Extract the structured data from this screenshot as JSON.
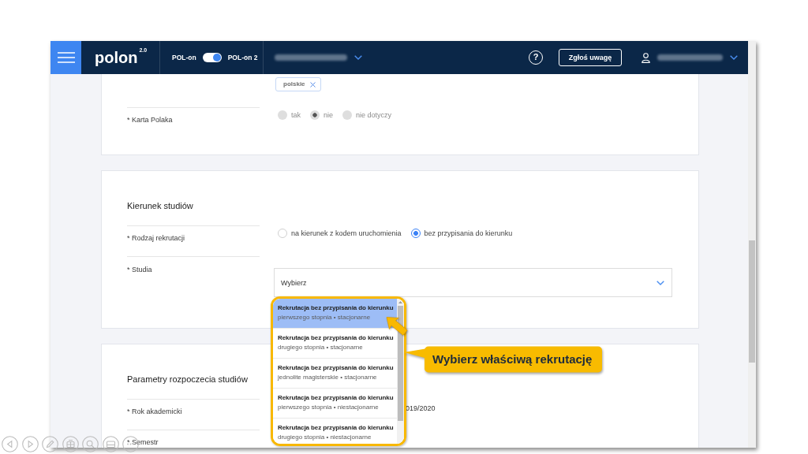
{
  "header": {
    "logo": "polon",
    "logo_version": "2.0",
    "switch": {
      "left_label": "POL-on",
      "on": true,
      "right_label": "POL-on 2"
    },
    "institution": {
      "blurred": true
    },
    "help": "?",
    "report_button": "Zgłoś uwagę",
    "user": {
      "blurred": true
    }
  },
  "sections": [
    {
      "fields": [
        {
          "kind": "chips",
          "chips": [
            {
              "label": "polskie"
            }
          ]
        },
        {
          "kind": "radio",
          "label": "* Karta Polaka",
          "disabled": true,
          "options": [
            {
              "label": "tak",
              "selected": false
            },
            {
              "label": "nie",
              "selected": true
            },
            {
              "label": "nie dotyczy",
              "selected": false
            }
          ]
        }
      ]
    },
    {
      "title": "Kierunek studiów",
      "fields": [
        {
          "kind": "radio",
          "label": "* Rodzaj rekrutacji",
          "disabled": false,
          "options": [
            {
              "label": "na kierunek z kodem uruchomienia",
              "selected": false
            },
            {
              "label": "bez przypisania do kierunku",
              "selected": true
            }
          ]
        },
        {
          "kind": "select",
          "label": "* Studia",
          "placeholder": "Wybierz",
          "expanded": true,
          "options": [
            {
              "title": "Rekrutacja bez przypisania do kierunku",
              "detail": "pierwszego stopnia • stacjonarne",
              "selected": true
            },
            {
              "title": "Rekrutacja bez przypisania do kierunku",
              "detail": "drugiego stopnia • stacjonarne",
              "selected": false
            },
            {
              "title": "Rekrutacja bez przypisania do kierunku",
              "detail": "jednolite magisterskie • stacjonarne",
              "selected": false
            },
            {
              "title": "Rekrutacja bez przypisania do kierunku",
              "detail": "pierwszego stopnia • niestacjonarne",
              "selected": false
            },
            {
              "title": "Rekrutacja bez przypisania do kierunku",
              "detail": "drugiego stopnia • niestacjonarne",
              "selected": false
            }
          ]
        }
      ]
    },
    {
      "title": "Parametry rozpoczecia studiów",
      "fields": [
        {
          "kind": "text",
          "label": "* Rok akademicki",
          "value": "019/2020"
        },
        {
          "kind": "text",
          "label": "* Semestr"
        }
      ]
    }
  ],
  "annotation": {
    "callout": "Wybierz właściwą rekrutację"
  }
}
